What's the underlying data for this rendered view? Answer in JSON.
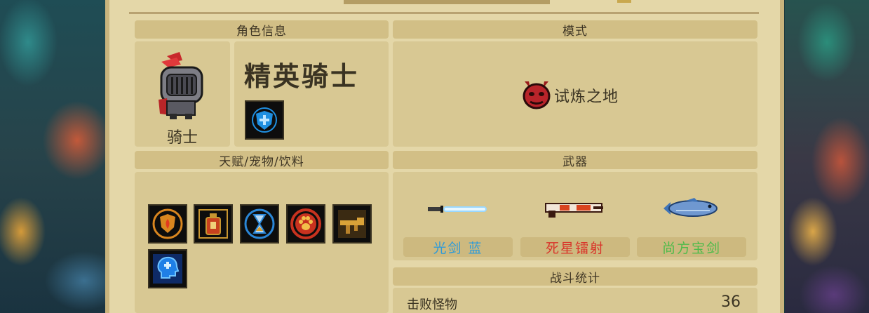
{
  "banner": {
    "title_bar_color": "#b49d64"
  },
  "sections": {
    "character": "角色信息",
    "mode": "模式",
    "talents": "天赋/宠物/饮料",
    "weapons": "武器",
    "battle_stats": "战斗统计"
  },
  "character": {
    "name": "精英骑士",
    "class": "骑士",
    "portrait_icon": "knight-helmet-icon",
    "skill_icon": "blue-shield-icon"
  },
  "mode": {
    "name": "试炼之地",
    "icon": "demon-mask-icon"
  },
  "talents": [
    {
      "icon": "fire-shield-icon"
    },
    {
      "icon": "potion-bottle-icon"
    },
    {
      "icon": "hourglass-icon"
    },
    {
      "icon": "paw-icon"
    },
    {
      "icon": "golden-rifle-icon"
    },
    {
      "icon": "blue-head-icon"
    }
  ],
  "weapons": [
    {
      "name": "光剑 蓝",
      "color": "#2f9bd8",
      "icon": "blue-lightsaber-icon"
    },
    {
      "name": "死星镭射",
      "color": "#d9352a",
      "icon": "laser-gun-icon"
    },
    {
      "name": "尚方宝剑",
      "color": "#4dbb4a",
      "icon": "fish-sword-icon"
    }
  ],
  "stats": [
    {
      "label": "击败怪物",
      "value": "36"
    }
  ]
}
